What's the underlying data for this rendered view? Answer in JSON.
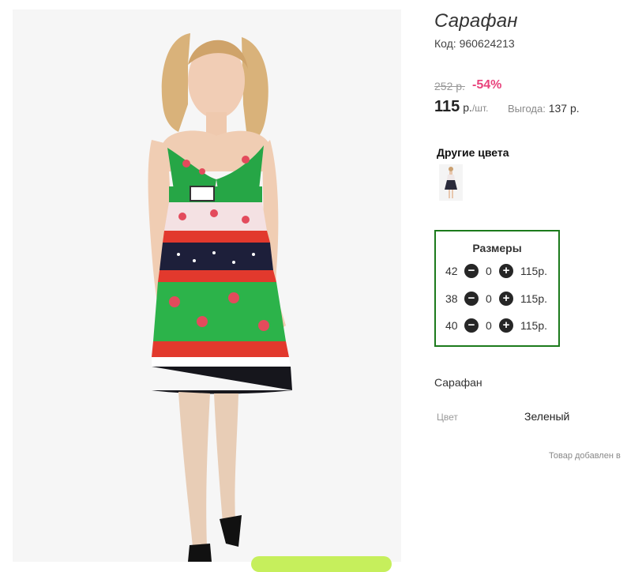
{
  "product": {
    "title": "Сарафан",
    "code": "Код: 960624213",
    "old_price": "252 р.",
    "discount": "-54%",
    "price_value": "115",
    "price_currency": "р.",
    "price_unit": "/шт.",
    "benefit_label": "Выгода:",
    "benefit_value": "137 р."
  },
  "other_colors": {
    "title": "Другие цвета"
  },
  "sizes": {
    "title": "Размеры",
    "rows": [
      {
        "size": "42",
        "qty": "0",
        "price": "115р."
      },
      {
        "size": "38",
        "qty": "0",
        "price": "115р."
      },
      {
        "size": "40",
        "qty": "0",
        "price": "115р."
      }
    ],
    "minus_symbol": "−",
    "plus_symbol": "+"
  },
  "description": {
    "title": "Сарафан",
    "attributes": [
      {
        "label": "Цвет",
        "value": "Зеленый"
      }
    ]
  },
  "notice": "Товар добавлен в",
  "colors": {
    "sizes_border": "#1c7a1c",
    "discount": "#e8437c",
    "cart_button": "#c6ef5c"
  }
}
